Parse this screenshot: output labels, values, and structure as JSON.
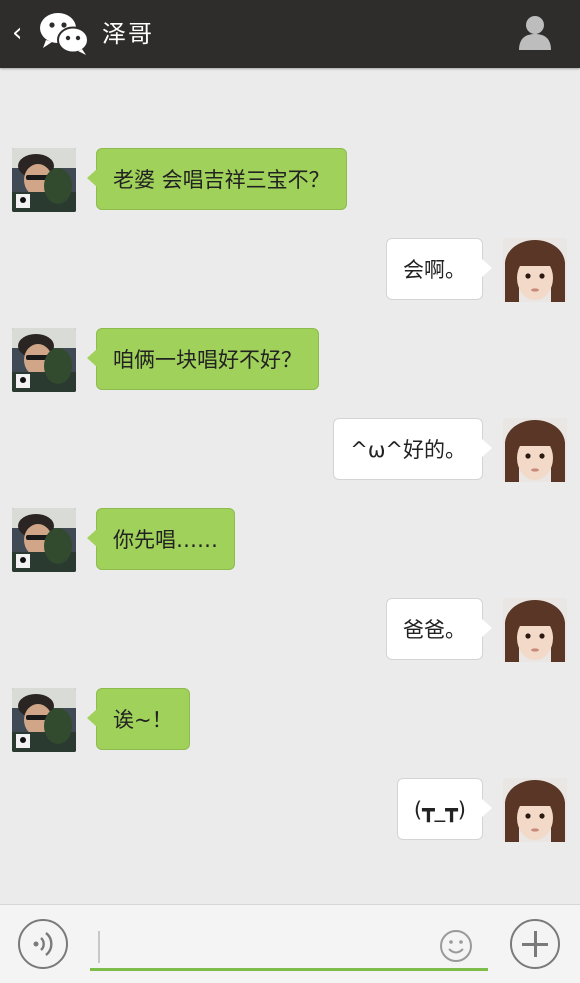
{
  "header": {
    "title": "泽哥",
    "back_icon": "chevron-left-icon",
    "app_icon": "wechat-icon",
    "profile_icon": "person-icon"
  },
  "messages": [
    {
      "side": "left",
      "sender": "泽哥",
      "text": "老婆 会唱吉祥三宝不？"
    },
    {
      "side": "right",
      "sender": "me",
      "text": "会啊。"
    },
    {
      "side": "left",
      "sender": "泽哥",
      "text": "咱俩一块唱好不好？"
    },
    {
      "side": "right",
      "sender": "me",
      "text": "^ω^好的。"
    },
    {
      "side": "left",
      "sender": "泽哥",
      "text": "你先唱……"
    },
    {
      "side": "right",
      "sender": "me",
      "text": "爸爸。"
    },
    {
      "side": "left",
      "sender": "泽哥",
      "text": "诶~！"
    },
    {
      "side": "right",
      "sender": "me",
      "text": "(┳_┳)"
    }
  ],
  "input_bar": {
    "voice_icon": "voice-icon",
    "input_value": "",
    "emoji_icon": "smiley-icon",
    "plus_icon": "plus-icon"
  },
  "colors": {
    "header_bg": "#2f2d2c",
    "background": "#ebebeb",
    "sent_bubble": "#a0d15a",
    "received_bubble": "#ffffff",
    "input_underline": "#7fbd4a"
  }
}
